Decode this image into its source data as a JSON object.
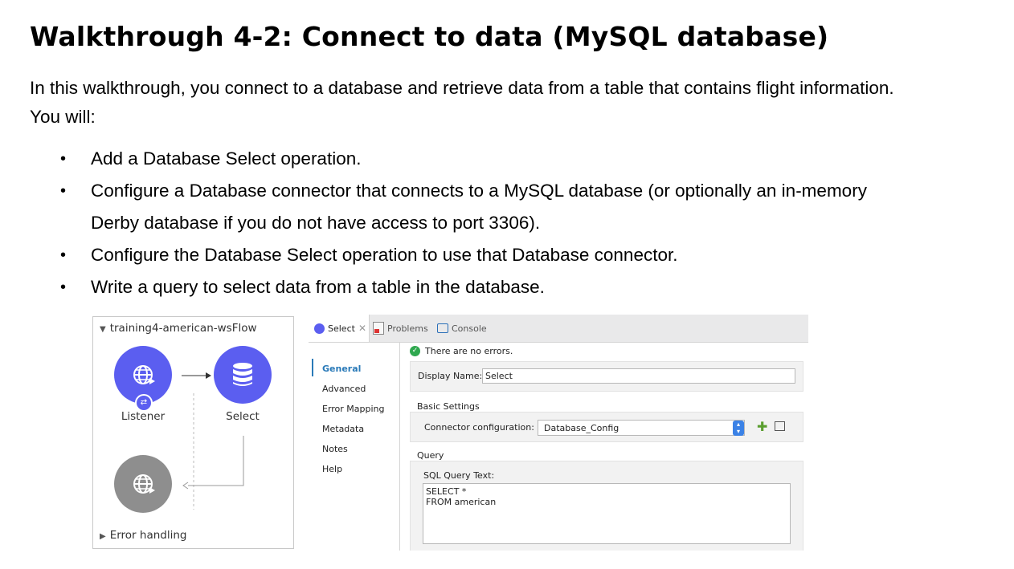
{
  "doc": {
    "title": "Walkthrough 4-2: Connect to data (MySQL database)",
    "intro_line1": "In this walkthrough, you connect to a database and retrieve data from a table that contains flight information.",
    "intro_line2": "You will:",
    "bullets": [
      "Add a Database Select operation.",
      "Configure a Database connector that connects to a MySQL database (or optionally an in-memory",
      "Derby database if you do not have access to port 3306).",
      "Configure the Database Select operation to use that Database connector.",
      "Write a query to select data from a table in the database."
    ],
    "bullet_char": "•"
  },
  "flow": {
    "title": "training4-american-wsFlow",
    "nodes": [
      {
        "label": "Listener",
        "icon": "globe-icon",
        "color": "#5b5ef0"
      },
      {
        "label": "Select",
        "icon": "database-icon",
        "color": "#5b5ef0"
      },
      {
        "label": "",
        "icon": "globe-icon",
        "color": "#8e8e8e"
      }
    ],
    "error_handling": "Error handling"
  },
  "props": {
    "tabs": [
      {
        "label": "Select",
        "icon": "db-tab-icon"
      },
      {
        "label": "Problems",
        "icon": "problems-icon"
      },
      {
        "label": "Console",
        "icon": "console-icon"
      }
    ],
    "nav": [
      "General",
      "Advanced",
      "Error Mapping",
      "Metadata",
      "Notes",
      "Help"
    ],
    "message": "There are no errors.",
    "display_name_label": "Display Name:",
    "display_name_value": "Select",
    "basic_settings": "Basic Settings",
    "connector_label": "Connector configuration:",
    "connector_value": "Database_Config",
    "query_section": "Query",
    "sql_label": "SQL Query Text:",
    "sql_value": "SELECT *\nFROM american",
    "colors": {
      "accent": "#2a7ab8",
      "ok": "#2fa84f",
      "node": "#5b5ef0"
    }
  }
}
